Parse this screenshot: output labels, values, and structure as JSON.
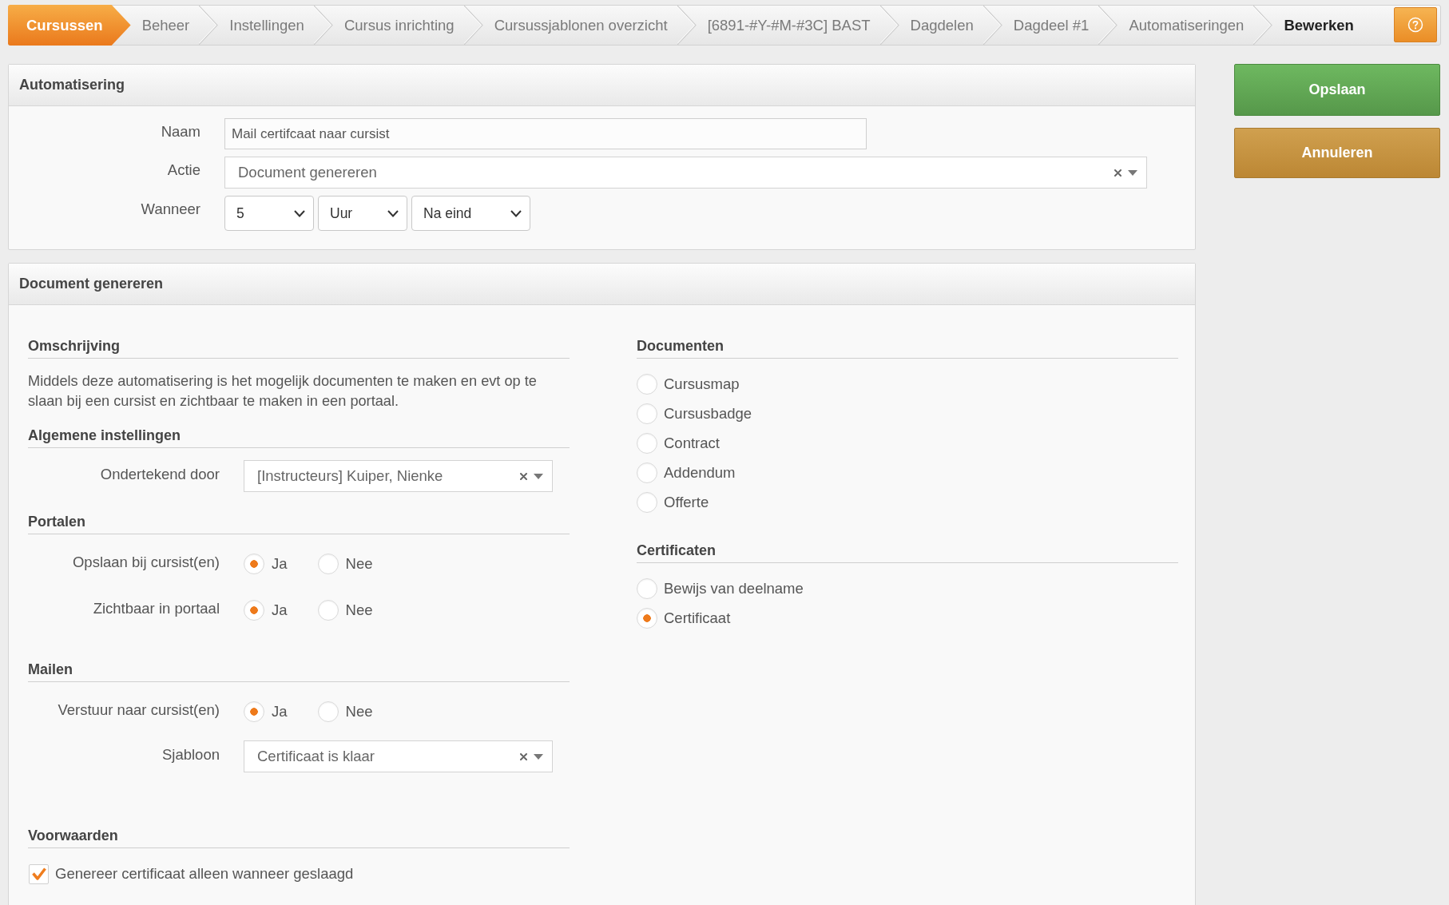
{
  "breadcrumbs": [
    {
      "label": "Cursussen",
      "kind": "module"
    },
    {
      "label": "Beheer",
      "kind": "link"
    },
    {
      "label": "Instellingen",
      "kind": "link"
    },
    {
      "label": "Cursus inrichting",
      "kind": "link"
    },
    {
      "label": "Cursussjablonen overzicht",
      "kind": "link"
    },
    {
      "label": "[6891-#Y-#M-#3C] BAST",
      "kind": "link"
    },
    {
      "label": "Dagdelen",
      "kind": "link"
    },
    {
      "label": "Dagdeel #1",
      "kind": "link"
    },
    {
      "label": "Automatiseringen",
      "kind": "link"
    },
    {
      "label": "Bewerken",
      "kind": "current"
    }
  ],
  "automation_panel": {
    "title": "Automatisering",
    "fields": [
      {
        "label": "Naam",
        "kind": "text",
        "value": "Mail certifcaat naar cursist"
      },
      {
        "label": "Actie",
        "kind": "combo",
        "value": "Document genereren"
      },
      {
        "label": "Wanneer",
        "kind": "selects",
        "values": [
          "5",
          "Uur",
          "Na eind"
        ]
      }
    ]
  },
  "actions": [
    {
      "label": "Opslaan",
      "kind": "save"
    },
    {
      "label": "Annuleren",
      "kind": "cancel"
    }
  ],
  "document_panel": {
    "title": "Document genereren",
    "left_column": [
      {
        "heading": "Omschrijving",
        "items": [
          {
            "kind": "paragraph",
            "text": "Middels deze automatisering is het mogelijk documenten te maken en evt op te slaan bij een cursist en zichtbaar te maken in een portaal."
          }
        ]
      },
      {
        "heading": "Algemene instellingen",
        "items": [
          {
            "kind": "combo",
            "label": "Ondertekend door",
            "value": "[Instructeurs] Kuiper, Nienke"
          }
        ]
      },
      {
        "heading": "Portalen",
        "items": [
          {
            "kind": "choice",
            "label": "Opslaan bij cursist(en)",
            "options": [
              {
                "label": "Ja",
                "selected": true
              },
              {
                "label": "Nee",
                "selected": false
              }
            ]
          },
          {
            "kind": "choice",
            "label": "Zichtbaar in portaal",
            "options": [
              {
                "label": "Ja",
                "selected": true
              },
              {
                "label": "Nee",
                "selected": false
              }
            ]
          }
        ]
      },
      {
        "heading": "Mailen",
        "items": [
          {
            "kind": "choice",
            "label": "Verstuur naar cursist(en)",
            "options": [
              {
                "label": "Ja",
                "selected": true
              },
              {
                "label": "Nee",
                "selected": false
              }
            ]
          },
          {
            "kind": "combo",
            "label": "Sjabloon",
            "value": "Certificaat is klaar"
          }
        ]
      },
      {
        "heading": "Voorwaarden",
        "items": [
          {
            "kind": "checkbox",
            "label": "Genereer certificaat alleen wanneer geslaagd",
            "checked": true
          }
        ]
      }
    ],
    "right_column": [
      {
        "heading": "Documenten",
        "items": [
          {
            "kind": "radio",
            "label": "Cursusmap",
            "selected": false
          },
          {
            "kind": "radio",
            "label": "Cursusbadge",
            "selected": false
          },
          {
            "kind": "radio",
            "label": "Contract",
            "selected": false
          },
          {
            "kind": "radio",
            "label": "Addendum",
            "selected": false
          },
          {
            "kind": "radio",
            "label": "Offerte",
            "selected": false
          }
        ]
      },
      {
        "heading": "Certificaten",
        "items": [
          {
            "kind": "radio",
            "label": "Bewijs van deelname",
            "selected": false
          },
          {
            "kind": "radio",
            "label": "Certificaat",
            "selected": true
          }
        ]
      }
    ]
  }
}
